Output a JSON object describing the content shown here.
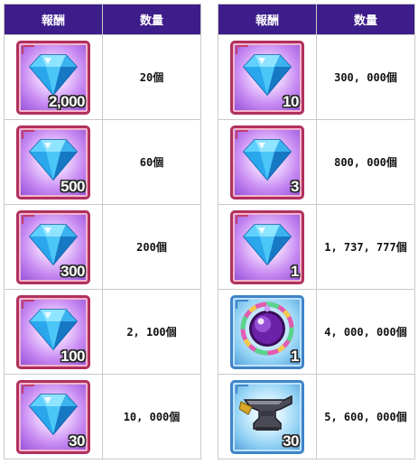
{
  "colors": {
    "header_bg": "#3d1d8a",
    "header_text": "#ffffff",
    "grid_line": "#c9c9c9",
    "card_frame_pink": "#b0305e",
    "card_frame_blue": "#3f84c9",
    "gem_blue": "#35b9f2"
  },
  "left_table": {
    "header_reward": "報酬",
    "header_quantity": "数量",
    "rows": [
      {
        "icon": "blue-gem-icon",
        "count": "2,000",
        "quantity": "20個"
      },
      {
        "icon": "blue-gem-icon",
        "count": "500",
        "quantity": "60個"
      },
      {
        "icon": "blue-gem-icon",
        "count": "300",
        "quantity": "200個"
      },
      {
        "icon": "blue-gem-icon",
        "count": "100",
        "quantity": "2, 100個"
      },
      {
        "icon": "blue-gem-icon",
        "count": "30",
        "quantity": "10, 000個"
      }
    ]
  },
  "right_table": {
    "header_reward": "報酬",
    "header_quantity": "数量",
    "rows": [
      {
        "icon": "blue-gem-icon",
        "count": "10",
        "quantity": "300, 000個"
      },
      {
        "icon": "blue-gem-icon",
        "count": "3",
        "quantity": "800, 000個"
      },
      {
        "icon": "blue-gem-icon",
        "count": "1",
        "quantity": "1, 737, 777個"
      },
      {
        "icon": "purple-orb-icon",
        "count": "1",
        "quantity": "4, 000, 000個"
      },
      {
        "icon": "anvil-icon",
        "count": "30",
        "quantity": "5, 600, 000個"
      }
    ]
  }
}
